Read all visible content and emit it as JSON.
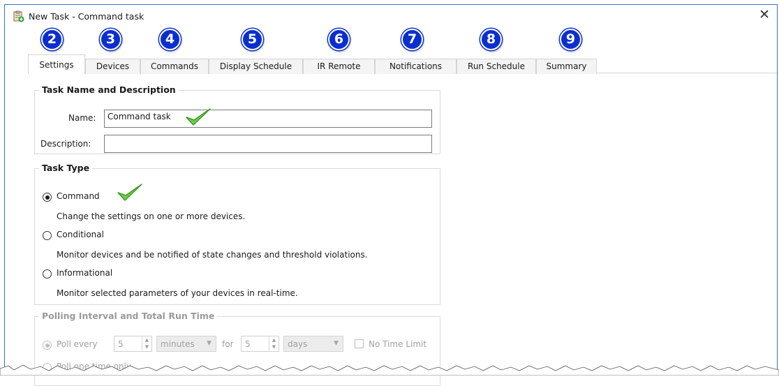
{
  "window": {
    "title": "New Task - Command task",
    "close_glyph": "✕"
  },
  "tabs": [
    {
      "label": "Settings",
      "badge": "2",
      "active": true
    },
    {
      "label": "Devices",
      "badge": "3"
    },
    {
      "label": "Commands",
      "badge": "4"
    },
    {
      "label": "Display Schedule",
      "badge": "5"
    },
    {
      "label": "IR Remote",
      "badge": "6"
    },
    {
      "label": "Notifications",
      "badge": "7"
    },
    {
      "label": "Run Schedule",
      "badge": "8"
    },
    {
      "label": "Summary",
      "badge": "9"
    }
  ],
  "task_name_group": {
    "title": "Task Name and Description",
    "name_label": "Name:",
    "name_value": "Command task",
    "description_label": "Description:",
    "description_value": ""
  },
  "task_type_group": {
    "title": "Task Type",
    "options": [
      {
        "label": "Command",
        "description": "Change the settings on one or more devices.",
        "selected": true
      },
      {
        "label": "Conditional",
        "description": "Monitor devices and be notified of state changes and threshold violations.",
        "selected": false
      },
      {
        "label": "Informational",
        "description": "Monitor selected parameters of your devices in real-time.",
        "selected": false
      }
    ]
  },
  "polling_group": {
    "title": "Polling Interval and Total Run Time",
    "poll_every_label": "Poll every",
    "poll_every_value": "5",
    "interval_unit": "minutes",
    "for_label": "for",
    "duration_value": "5",
    "duration_unit": "days",
    "no_time_limit_label": "No Time Limit",
    "poll_one_time_label": "Poll one time only"
  },
  "icons": {
    "app": "task-clipboard-icon",
    "checkmark": "green-checkmark-icon"
  },
  "colors": {
    "badge": "#0b2fcf",
    "checkmark": "#5cc238",
    "window_border": "#3a6fc4"
  }
}
